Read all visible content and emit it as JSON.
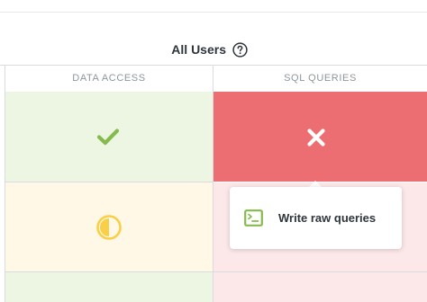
{
  "group": {
    "title": "All Users",
    "help_icon": "question-circle-icon"
  },
  "columns": [
    {
      "label": "DATA ACCESS"
    },
    {
      "label": "SQL QUERIES"
    }
  ],
  "rows": [
    {
      "data_access": {
        "icon": "check-icon",
        "status": "all",
        "color": "#84bb4c"
      },
      "sql_queries": {
        "icon": "close-icon",
        "status": "none",
        "color": "#ed6e72"
      }
    },
    {
      "data_access": {
        "icon": "half-circle-icon",
        "status": "limited",
        "color": "#f9cf48"
      },
      "sql_queries": {
        "status": "none"
      }
    },
    {
      "data_access": {
        "status": "all"
      },
      "sql_queries": {
        "status": "none"
      }
    }
  ],
  "tooltip": {
    "icon": "terminal-icon",
    "label": "Write raw queries",
    "icon_color": "#84bb4c"
  }
}
